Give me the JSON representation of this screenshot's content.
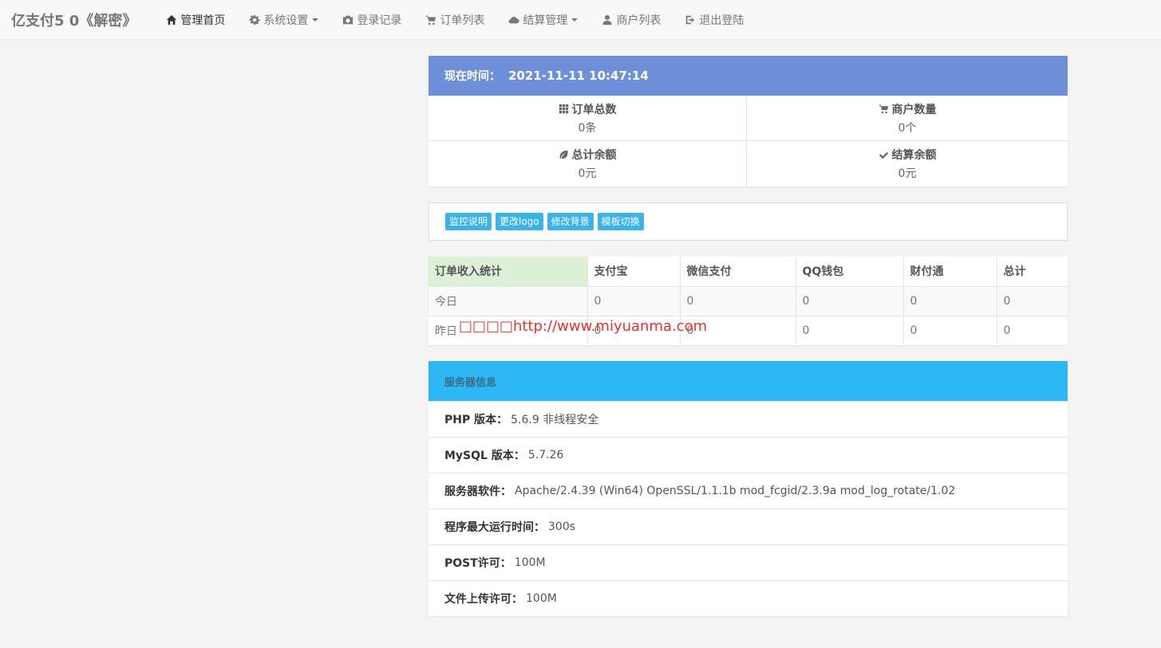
{
  "nav": {
    "brand": "亿支付5 0《解密》",
    "items": [
      {
        "label": "管理首页",
        "icon": "home-icon",
        "dropdown": false,
        "active": true
      },
      {
        "label": "系统设置",
        "icon": "gear-icon",
        "dropdown": true,
        "active": false
      },
      {
        "label": "登录记录",
        "icon": "camera-icon",
        "dropdown": false,
        "active": false
      },
      {
        "label": "订单列表",
        "icon": "cart-icon",
        "dropdown": false,
        "active": false
      },
      {
        "label": "结算管理",
        "icon": "cloud-icon",
        "dropdown": true,
        "active": false
      },
      {
        "label": "商户列表",
        "icon": "user-icon",
        "dropdown": false,
        "active": false
      },
      {
        "label": "退出登陆",
        "icon": "logout-icon",
        "dropdown": false,
        "active": false
      }
    ]
  },
  "time": {
    "label": "现在时间：",
    "value": "2021-11-11 10:47:14"
  },
  "stats": [
    {
      "label": "订单总数",
      "icon": "grid-icon",
      "value": "0条"
    },
    {
      "label": "商户数量",
      "icon": "cart-icon",
      "value": "0个"
    },
    {
      "label": "总计余额",
      "icon": "leaf-icon",
      "value": "0元"
    },
    {
      "label": "结算余额",
      "icon": "check-icon",
      "value": "0元"
    }
  ],
  "buttons": [
    "监控说明",
    "更改logo",
    "修改背景",
    "模板切换"
  ],
  "income": {
    "headers": [
      "订单收入统计",
      "支付宝",
      "微信支付",
      "QQ钱包",
      "财付通",
      "总计"
    ],
    "rows": [
      [
        "今日",
        "0",
        "0",
        "0",
        "0",
        "0"
      ],
      [
        "昨日",
        "0",
        "0",
        "0",
        "0",
        "0"
      ]
    ]
  },
  "watermark": "□□□□http://www.miyuanma.com",
  "server": {
    "title": "服务器信息",
    "rows": [
      {
        "key": "PHP 版本：",
        "value": "5.6.9 非线程安全"
      },
      {
        "key": "MySQL 版本：",
        "value": "5.7.26"
      },
      {
        "key": "服务器软件：",
        "value": "Apache/2.4.39 (Win64) OpenSSL/1.1.1b mod_fcgid/2.3.9a mod_log_rotate/1.02"
      },
      {
        "key": "程序最大运行时间：",
        "value": "300s"
      },
      {
        "key": "POST许可：",
        "value": "100M"
      },
      {
        "key": "文件上传许可：",
        "value": "100M"
      }
    ]
  },
  "colors": {
    "time_header": "#6f8fd8",
    "server_header": "#2db7f5",
    "button": "#3ab3e6",
    "watermark": "#e0312f",
    "income_head": "#dff0d8"
  }
}
